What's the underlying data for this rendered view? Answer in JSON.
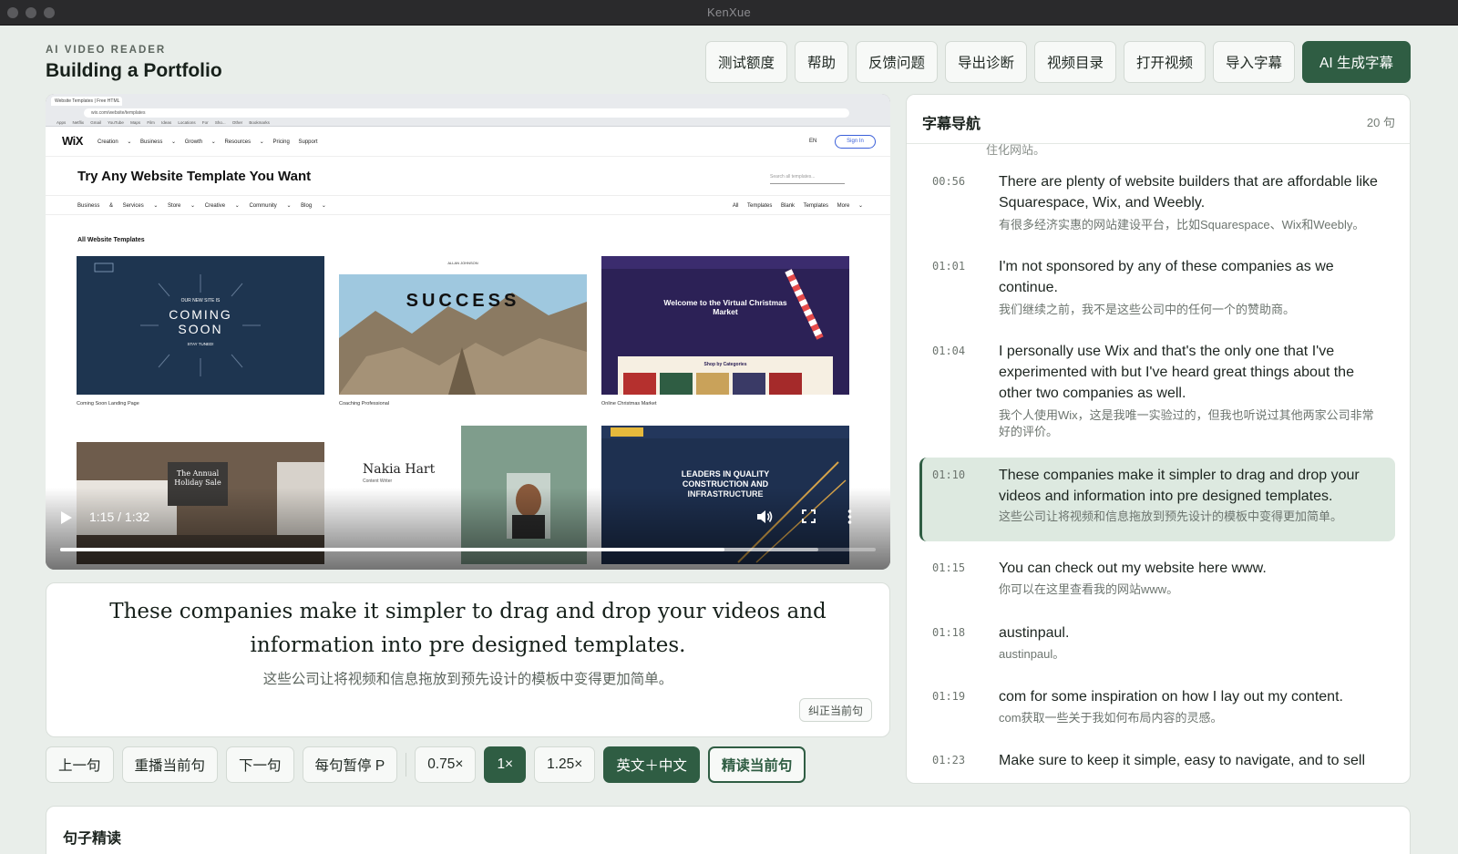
{
  "window": {
    "title": "KenXue"
  },
  "brand": {
    "kicker": "AI VIDEO READER",
    "title": "Building a Portfolio"
  },
  "toolbar": {
    "buttons": [
      "测试额度",
      "帮助",
      "反馈问题",
      "导出诊断",
      "视频目录",
      "打开视频",
      "导入字幕"
    ],
    "primary": "AI 生成字幕"
  },
  "video": {
    "time": "1:15 / 1:32",
    "progress": 0.815,
    "buffered": 0.93,
    "icons": {
      "play": "play-icon",
      "volume": "volume-icon",
      "fullscreen": "fullscreen-icon",
      "more": "more-vertical-icon"
    },
    "frame": {
      "tab": "Website Templates | Free HTML",
      "url": "wix.com/website/templates",
      "bookmarks": "Apps Netflix Gmail YouTube Maps Film Ideas Locations For Sho... Other Bookmarks",
      "logo": "WiX",
      "nav": "Creation ⌄ Business ⌄ Growth ⌄ Resources ⌄ Pricing Support",
      "lang": "EN",
      "signin": "Sign In",
      "headline": "Try Any Website Template You Want",
      "search": "Search all templates...",
      "cats_left": "Business & Services ⌄ Store ⌄ Creative ⌄ Community ⌄ Blog ⌄",
      "cats_right": "All Templates Blank Templates More ⌄",
      "section": "All Website Templates",
      "templates": [
        {
          "caption": "Coming Soon Landing Page",
          "text": "COMING SOON",
          "sub": "OUR NEW SITE IS",
          "foot": "STAY TUNED!"
        },
        {
          "caption": "Coaching Professional",
          "text": "SUCCESS",
          "sub": "ALLAN JOHNSON",
          "foot": ""
        },
        {
          "caption": "Online Christmas Market",
          "text": "Welcome to the Virtual Christmas Market",
          "sub": "Shop by Categories",
          "foot": ""
        },
        {
          "caption": "",
          "text": "The Annual Holiday Sale",
          "sub": "",
          "foot": ""
        },
        {
          "caption": "",
          "text": "Nakia Hart",
          "sub": "Content Writer",
          "foot": ""
        },
        {
          "caption": "",
          "text": "LEADERS IN QUALITY CONSTRUCTION AND INFRASTRUCTURE",
          "sub": "",
          "foot": ""
        }
      ]
    }
  },
  "caption": {
    "en": "These companies make it simpler to drag and drop your videos and information into pre designed templates.",
    "zh": "这些公司让将视频和信息拖放到预先设计的模板中变得更加简单。",
    "fix_button": "纠正当前句"
  },
  "controls": {
    "prev": "上一句",
    "replay": "重播当前句",
    "next": "下一句",
    "pause_each": "每句暂停 P",
    "speeds": [
      "0.75×",
      "1×",
      "1.25×"
    ],
    "active_speed": "1×",
    "lang_mode": "英文＋中文",
    "close_read": "精读当前句"
  },
  "subtitle_nav": {
    "title": "字幕导航",
    "count": "20 句",
    "partial_top": "住化网站。",
    "items": [
      {
        "time": "00:56",
        "en": "There are plenty of website builders that are affordable like Squarespace, Wix, and Weebly.",
        "zh": "有很多经济实惠的网站建设平台，比如Squarespace、Wix和Weebly。",
        "active": false
      },
      {
        "time": "01:01",
        "en": "I'm not sponsored by any of these companies as we continue.",
        "zh": "我们继续之前，我不是这些公司中的任何一个的赞助商。",
        "active": false
      },
      {
        "time": "01:04",
        "en": "I personally use Wix and that's the only one that I've experimented with but I've heard great things about the other two companies as well.",
        "zh": "我个人使用Wix，这是我唯一实验过的，但我也听说过其他两家公司非常好的评价。",
        "active": false
      },
      {
        "time": "01:10",
        "en": "These companies make it simpler to drag and drop your videos and information into pre designed templates.",
        "zh": "这些公司让将视频和信息拖放到预先设计的模板中变得更加简单。",
        "active": true
      },
      {
        "time": "01:15",
        "en": "You can check out my website here www.",
        "zh": "你可以在这里查看我的网站www。",
        "active": false
      },
      {
        "time": "01:18",
        "en": "austinpaul.",
        "zh": "austinpaul。",
        "active": false
      },
      {
        "time": "01:19",
        "en": "com for some inspiration on how I lay out my content.",
        "zh": "com获取一些关于我如何布局内容的灵感。",
        "active": false
      },
      {
        "time": "01:23",
        "en": "Make sure to keep it simple, easy to navigate, and to sell",
        "zh": "",
        "active": false
      }
    ]
  },
  "detail": {
    "title": "句子精读"
  },
  "colors": {
    "accent": "#2f5d43",
    "active_row": "#dde9e0",
    "background": "#e9eeea"
  }
}
